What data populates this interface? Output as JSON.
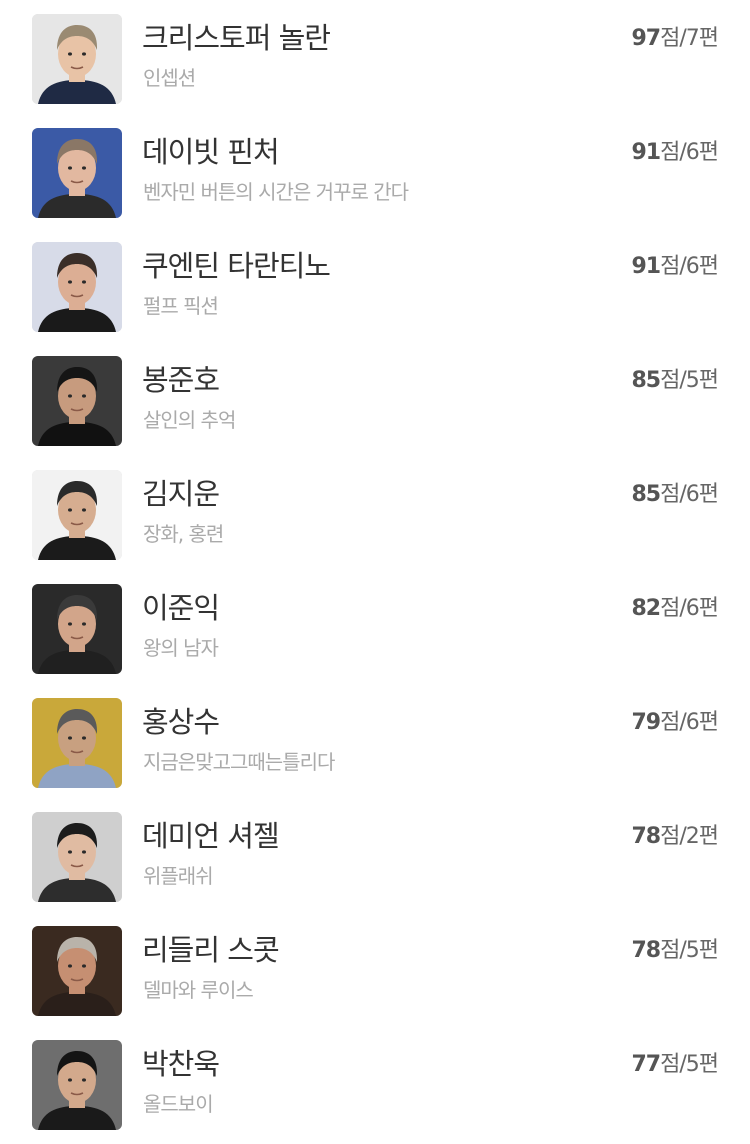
{
  "directors": [
    {
      "name": "크리스토퍼 놀란",
      "works": "인셉션",
      "points": "97",
      "count": "7",
      "bg": "#e6e6e6",
      "hair": "#9a8a72",
      "skin": "#e8c3a6",
      "shirt": "#1f2a44"
    },
    {
      "name": "데이빗 핀처",
      "works": "벤자민 버튼의 시간은 거꾸로 간다",
      "points": "91",
      "count": "6",
      "bg": "#3b5aa6",
      "hair": "#8a7766",
      "skin": "#e2b8a0",
      "shirt": "#2b2b2b"
    },
    {
      "name": "쿠엔틴 타란티노",
      "works": "펄프 픽션",
      "points": "91",
      "count": "6",
      "bg": "#d7dbe8",
      "hair": "#3a2e28",
      "skin": "#dcae94",
      "shirt": "#1a1a1a"
    },
    {
      "name": "봉준호",
      "works": "살인의 추억",
      "points": "85",
      "count": "5",
      "bg": "#3a3a3a",
      "hair": "#151515",
      "skin": "#c79b7e",
      "shirt": "#111111"
    },
    {
      "name": "김지운",
      "works": "장화, 홍련",
      "points": "85",
      "count": "6",
      "bg": "#f2f2f2",
      "hair": "#2a2a2a",
      "skin": "#d6ad90",
      "shirt": "#1b1b1b"
    },
    {
      "name": "이준익",
      "works": "왕의 남자",
      "points": "82",
      "count": "6",
      "bg": "#2a2a2a",
      "hair": "#3a3a3a",
      "skin": "#d2a58a",
      "shirt": "#202020"
    },
    {
      "name": "홍상수",
      "works": "지금은맞고그때는틀리다",
      "points": "79",
      "count": "6",
      "bg": "#c9a83a",
      "hair": "#5a5a5a",
      "skin": "#c8a080",
      "shirt": "#8fa3c4"
    },
    {
      "name": "데미언 셔젤",
      "works": "위플래쉬",
      "points": "78",
      "count": "2",
      "bg": "#cfcfcf",
      "hair": "#1c1c1c",
      "skin": "#e0bba2",
      "shirt": "#2d2d2d"
    },
    {
      "name": "리들리 스콧",
      "works": "델마와 루이스",
      "points": "78",
      "count": "5",
      "bg": "#3a2a20",
      "hair": "#b9b3aa",
      "skin": "#c68f72",
      "shirt": "#2a1f1a"
    },
    {
      "name": "박찬욱",
      "works": "올드보이",
      "points": "77",
      "count": "5",
      "bg": "#6e6e6e",
      "hair": "#141414",
      "skin": "#d3a98c",
      "shirt": "#1a1a1a"
    }
  ],
  "labels": {
    "points_suffix": "점/",
    "count_suffix": "편"
  }
}
